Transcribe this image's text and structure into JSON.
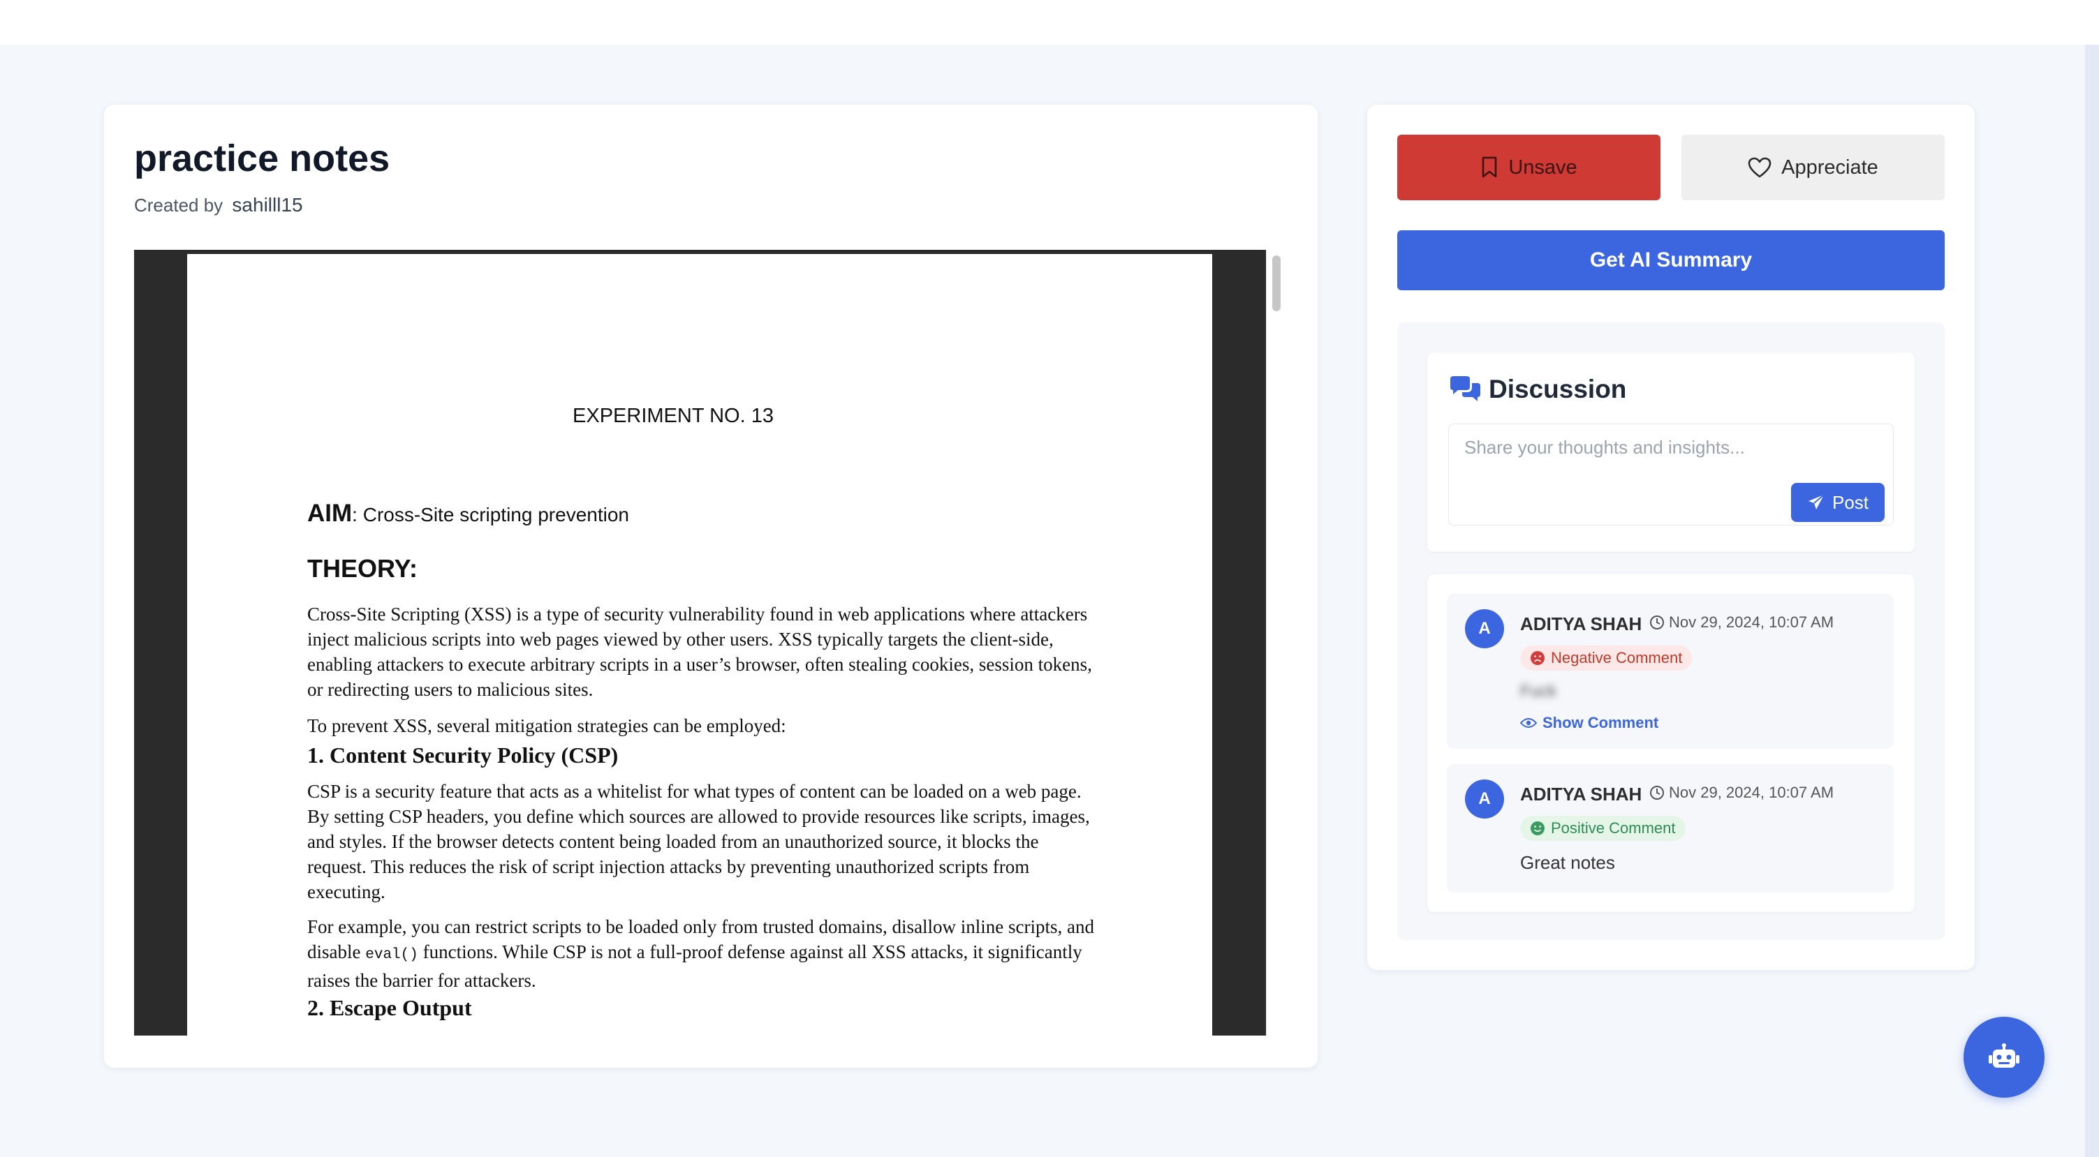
{
  "note": {
    "title": "practice notes",
    "created_by_label": "Created by",
    "author": "sahilll15"
  },
  "document": {
    "experiment_title": "EXPERIMENT NO. 13",
    "aim_label": "AIM",
    "aim_text": "Cross-Site scripting prevention",
    "theory_heading": "THEORY:",
    "para1": "Cross-Site Scripting (XSS) is a type of security vulnerability found in web applications where attackers inject malicious scripts into web pages viewed by other users. XSS typically targets the client-side, enabling attackers to execute arbitrary scripts in a user’s browser, often stealing cookies, session tokens, or redirecting users to malicious sites.",
    "para2": "To prevent XSS, several mitigation strategies can be employed:",
    "heading_csp": "1. Content Security Policy (CSP)",
    "para3": "CSP is a security feature that acts as a whitelist for what types of content can be loaded on a web page. By setting CSP headers, you define which sources are allowed to provide resources like scripts, images, and styles. If the browser detects content being loaded from an unauthorized source, it blocks the request. This reduces the risk of script injection attacks by preventing unauthorized scripts from executing.",
    "para4_before": "For example, you can restrict scripts to be loaded only from trusted domains, disallow inline scripts, and disable ",
    "para4_code": "eval()",
    "para4_after": " functions. While CSP is not a full-proof defense against all XSS attacks, it significantly raises the barrier for attackers.",
    "heading_escape": "2. Escape Output"
  },
  "actions": {
    "unsave_label": "Unsave",
    "appreciate_label": "Appreciate",
    "ai_summary_label": "Get AI Summary"
  },
  "discussion": {
    "title": "Discussion",
    "placeholder": "Share your thoughts and insights...",
    "post_label": "Post",
    "comments": [
      {
        "avatar": "A",
        "author": "ADITYA SHAH",
        "time": "Nov 29, 2024, 10:07 AM",
        "sentiment": "Negative Comment",
        "hidden_text": "Fuck",
        "show_label": "Show Comment"
      },
      {
        "avatar": "A",
        "author": "ADITYA SHAH",
        "time": "Nov 29, 2024, 10:07 AM",
        "sentiment": "Positive Comment",
        "text": "Great notes"
      }
    ]
  },
  "icons": {
    "unsave": "bookmark-icon",
    "appreciate": "heart-icon",
    "discussion": "chat-bubbles-icon",
    "post": "paper-plane-icon",
    "time": "clock-icon",
    "negative": "frown-icon",
    "positive": "smile-icon",
    "show": "eye-icon",
    "assistant": "robot-icon"
  },
  "colors": {
    "primary": "#3b66e0",
    "danger": "#cf3a34",
    "negative_badge": "#fde8e8",
    "positive_badge": "#e5f6e9"
  }
}
